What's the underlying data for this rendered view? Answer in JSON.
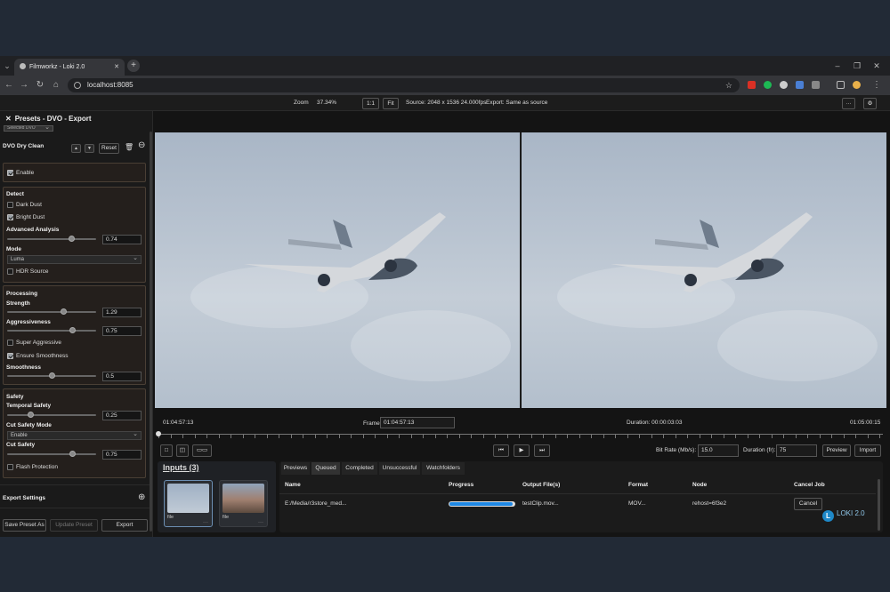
{
  "browser": {
    "tab_title": "Filmworkz - Loki 2.0",
    "url": "localhost:8085"
  },
  "viewer_bar": {
    "zoom_label": "Zoom",
    "zoom_value": "37.34%",
    "one_to_one": "1:1",
    "fit": "Fit",
    "source": "Source: 2048 x 1536 24.000fps",
    "export": "Export: Same as source",
    "more": "···"
  },
  "panel": {
    "title": "Presets - DVO - Export",
    "preset_select": "Selected DVO",
    "section_title": "DVO Dry Clean",
    "reset": "Reset",
    "enable": {
      "label": "Enable",
      "checked": true
    },
    "detect": {
      "title": "Detect",
      "dark_dust": {
        "label": "Dark Dust",
        "checked": false
      },
      "bright_dust": {
        "label": "Bright Dust",
        "checked": true
      },
      "advanced_analysis": {
        "label": "Advanced Analysis",
        "value": "0.74",
        "level": 0.74
      },
      "mode": {
        "label": "Mode",
        "value": "Luma"
      },
      "hdr_source": {
        "label": "HDR Source",
        "checked": false
      }
    },
    "processing": {
      "title": "Processing",
      "strength": {
        "label": "Strength",
        "value": "1.29",
        "level": 0.65
      },
      "aggressiveness": {
        "label": "Aggressiveness",
        "value": "0.75",
        "level": 0.75
      },
      "super_aggressive": {
        "label": "Super Aggressive",
        "checked": false
      },
      "ensure_smoothness": {
        "label": "Ensure Smoothness",
        "checked": true
      },
      "smoothness": {
        "label": "Smoothness",
        "value": "0.5",
        "level": 0.5
      }
    },
    "safety": {
      "title": "Safety",
      "temporal_safety": {
        "label": "Temporal Safety",
        "value": "0.25",
        "level": 0.25
      },
      "cut_safety_mode": {
        "label": "Cut Safety Mode",
        "value": "Enable"
      },
      "cut_safety": {
        "label": "Cut Safety",
        "value": "0.75",
        "level": 0.75
      },
      "flash_protection": {
        "label": "Flash Protection",
        "checked": false
      }
    },
    "export_settings": "Export Settings",
    "save_preset_as": "Save Preset As",
    "update_preset": "Update Preset",
    "export": "Export"
  },
  "timeline": {
    "start": "01:04:57:13",
    "frame_label": "Frame",
    "frame_value": "01:04:57:13",
    "duration": "Duration: 00:00:03:03",
    "end": "01:05:00:15"
  },
  "controls": {
    "bitrate_label": "Bit Rate (Mb/s):",
    "bitrate_value": "15.0",
    "duration_label": "Duration (fr):",
    "duration_value": "75",
    "preview": "Preview",
    "import": "Import"
  },
  "inputs": {
    "title": "Inputs (3)",
    "items": [
      {
        "name": "file"
      },
      {
        "name": "file"
      }
    ]
  },
  "jobs": {
    "tabs": [
      "Previews",
      "Queued",
      "Completed",
      "Unsuccessful",
      "Watchfolders"
    ],
    "active_tab": "Queued",
    "headers": {
      "name": "Name",
      "progress": "Progress",
      "output": "Output File(s)",
      "format": "Format",
      "node": "Node",
      "cancel": "Cancel Job"
    },
    "rows": [
      {
        "name": "E:/Media/r3store_med...",
        "progress": 0.97,
        "output": "testClip.mov...",
        "format": "MOV...",
        "node": "rehost=6f3e2",
        "cancel": "Cancel"
      }
    ]
  },
  "brand": {
    "logo": "L",
    "name": "LOKI 2.0"
  },
  "colors": {
    "accent": "#1e88e5",
    "panel_border": "#4a3f35",
    "brand": "#1e88c8"
  }
}
